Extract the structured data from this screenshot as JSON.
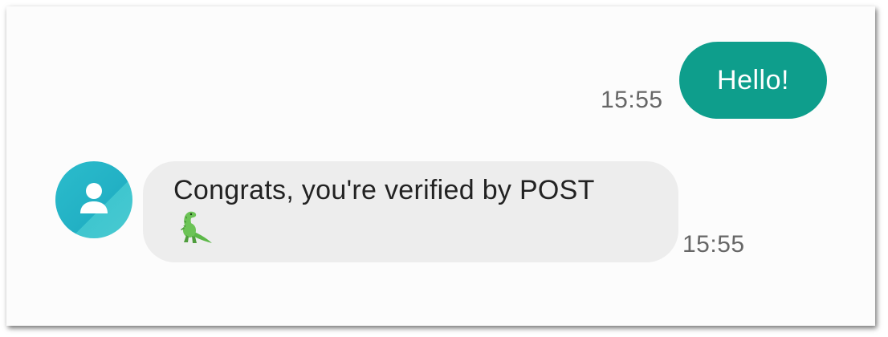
{
  "conversation": {
    "outgoing": {
      "text": "Hello!",
      "time": "15:55"
    },
    "incoming": {
      "text": "Congrats, you're verified by POST",
      "emoji_icon": "t-rex-emoji-icon",
      "time": "15:55",
      "avatar_icon": "person-icon"
    }
  },
  "colors": {
    "outgoing_bubble": "#0e9e8c",
    "incoming_bubble": "#ededed",
    "avatar": "#22b0c4",
    "timestamp": "#666666"
  }
}
